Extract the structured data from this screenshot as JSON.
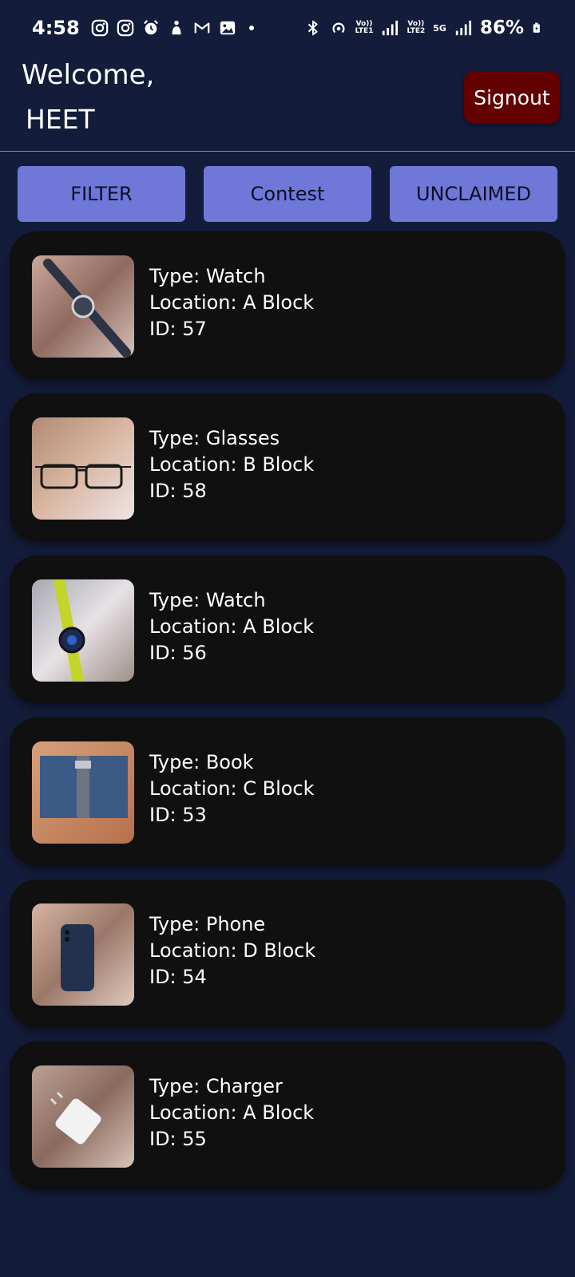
{
  "status_bar": {
    "time": "4:58",
    "battery": "86%",
    "sim1_tag_top": "Vo))",
    "sim1_tag_bottom": "LTE1",
    "sim2_tag_top": "Vo))",
    "sim2_tag_bottom": "LTE2",
    "network_type": "5G"
  },
  "header": {
    "welcome": "Welcome,",
    "username": "HEET",
    "signout_label": "Signout"
  },
  "filters": {
    "filter_label": "FILTER",
    "contest_label": "Contest",
    "unclaimed_label": "UNCLAIMED"
  },
  "items": [
    {
      "type": "Type: Watch",
      "location": "Location: A Block",
      "id": "ID: 57",
      "image": "watch-photo"
    },
    {
      "type": "Type: Glasses",
      "location": "Location: B Block",
      "id": "ID: 58",
      "image": "glasses-photo"
    },
    {
      "type": "Type: Watch",
      "location": "Location: A Block",
      "id": "ID: 56",
      "image": "smartwatch-photo"
    },
    {
      "type": "Type: Book",
      "location": "Location: C Block",
      "id": "ID: 53",
      "image": "book-photo"
    },
    {
      "type": "Type: Phone",
      "location": "Location: D Block",
      "id": "ID: 54",
      "image": "phone-photo"
    },
    {
      "type": "Type: Charger",
      "location": "Location: A Block",
      "id": "ID: 55",
      "image": "charger-photo"
    }
  ],
  "colors": {
    "background": "#131c3a",
    "card": "#101010",
    "pill": "#6f77d8",
    "signout": "#630000"
  }
}
